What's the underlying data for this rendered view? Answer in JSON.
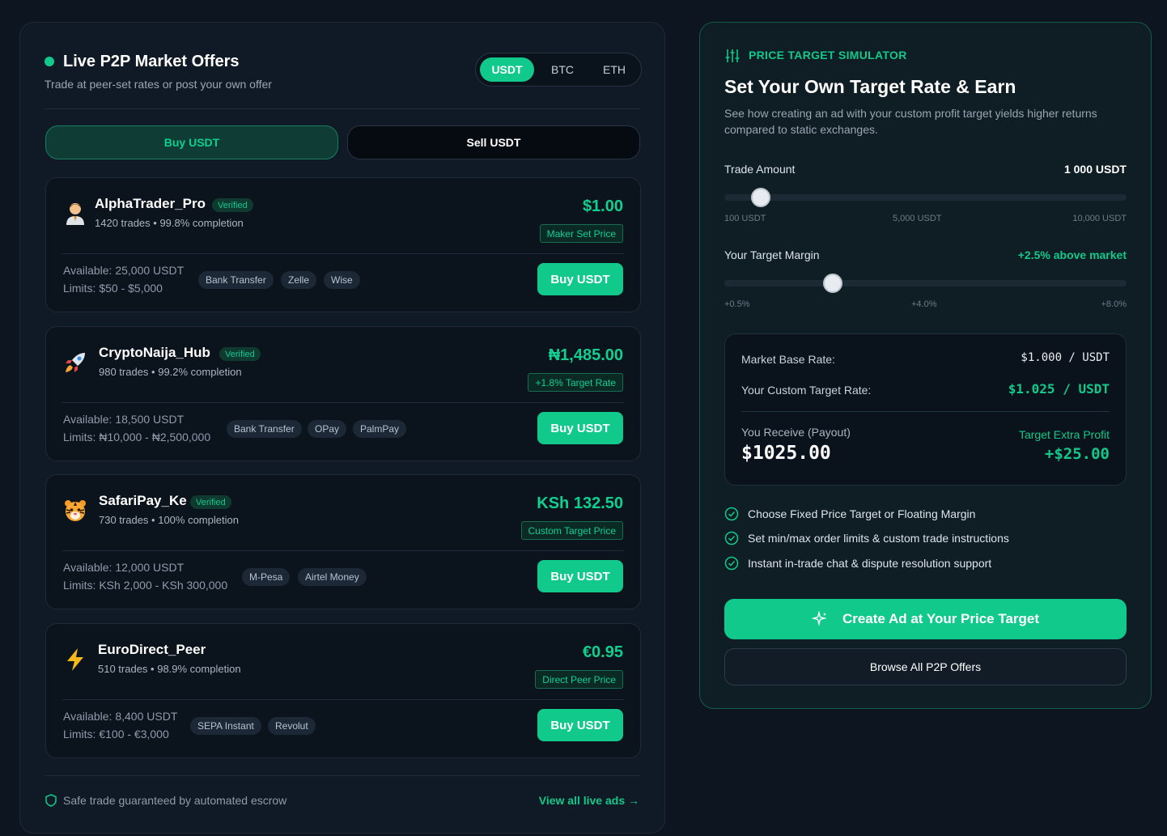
{
  "market": {
    "title": "Live P2P Market Offers",
    "subtitle": "Trade at peer-set rates or post your own offer",
    "assets": [
      "USDT",
      "BTC",
      "ETH"
    ],
    "selected_asset": "USDT",
    "tabs": {
      "buy": "Buy USDT",
      "sell": "Sell USDT"
    },
    "offers": [
      {
        "name": "AlphaTrader_Pro",
        "verified": "Verified",
        "avatar_icon": "person-icon",
        "stats": "1420 trades • 99.8% completion",
        "price": "$1.00",
        "price_tag": "Maker Set Price",
        "available": "Available: 25,000 USDT",
        "limits": "Limits: $50 - $5,000",
        "methods": [
          "Bank Transfer",
          "Zelle",
          "Wise"
        ],
        "action": "Buy USDT"
      },
      {
        "name": "CryptoNaija_Hub",
        "verified": "Verified",
        "avatar_icon": "rocket-icon",
        "stats": "980 trades • 99.2% completion",
        "price": "₦1,485.00",
        "price_tag": "+1.8% Target Rate",
        "available": "Available: 18,500 USDT",
        "limits": "Limits: ₦10,000 - ₦2,500,000",
        "methods": [
          "Bank Transfer",
          "OPay",
          "PalmPay"
        ],
        "action": "Buy USDT"
      },
      {
        "name": "SafariPay_Ke",
        "verified": "Verified",
        "avatar_icon": "tiger-icon",
        "stats": "730 trades • 100% completion",
        "price": "KSh 132.50",
        "price_tag": "Custom Target Price",
        "available": "Available: 12,000 USDT",
        "limits": "Limits: KSh 2,000 - KSh 300,000",
        "methods": [
          "M-Pesa",
          "Airtel Money"
        ],
        "action": "Buy USDT"
      },
      {
        "name": "EuroDirect_Peer",
        "verified": "",
        "avatar_icon": "lightning-icon",
        "stats": "510 trades • 98.9% completion",
        "price": "€0.95",
        "price_tag": "Direct Peer Price",
        "available": "Available: 8,400 USDT",
        "limits": "Limits: €100 - €3,000",
        "methods": [
          "SEPA Instant",
          "Revolut"
        ],
        "action": "Buy USDT"
      }
    ],
    "escrow_note": "Safe trade guaranteed by automated escrow",
    "view_all": "View all live ads →"
  },
  "simulator": {
    "label": "PRICE TARGET SIMULATOR",
    "title": "Set Your Own Target Rate & Earn",
    "description": "See how creating an ad with your custom profit target yields higher returns compared to static exchanges.",
    "trade_amount": {
      "label": "Trade Amount",
      "value": "1 000 USDT",
      "fraction": 0.09,
      "ticks": [
        "100 USDT",
        "5,000 USDT",
        "10,000 USDT"
      ]
    },
    "target_margin": {
      "label": "Your Target Margin",
      "value": "+2.5% above market",
      "fraction": 0.27,
      "ticks": [
        "+0.5%",
        "+4.0%",
        "+8.0%"
      ]
    },
    "calc": {
      "market_base_label": "Market Base Rate:",
      "market_base_value": "$1.000 / USDT",
      "custom_label": "Your Custom Target Rate:",
      "custom_value": "$1.025 / USDT",
      "receive_label": "You Receive (Payout)",
      "receive_value": "$1025.00",
      "profit_label": "Target Extra Profit",
      "profit_value": "+$25.00"
    },
    "features": [
      "Choose Fixed Price Target or Floating Margin",
      "Set min/max order limits & custom trade instructions",
      "Instant in-trade chat & dispute resolution support"
    ],
    "cta": "Create Ad at Your Price Target",
    "browse": "Browse All P2P Offers"
  },
  "colors": {
    "accent": "#10c98a",
    "background": "#0d1520",
    "panel": "#101a26"
  }
}
